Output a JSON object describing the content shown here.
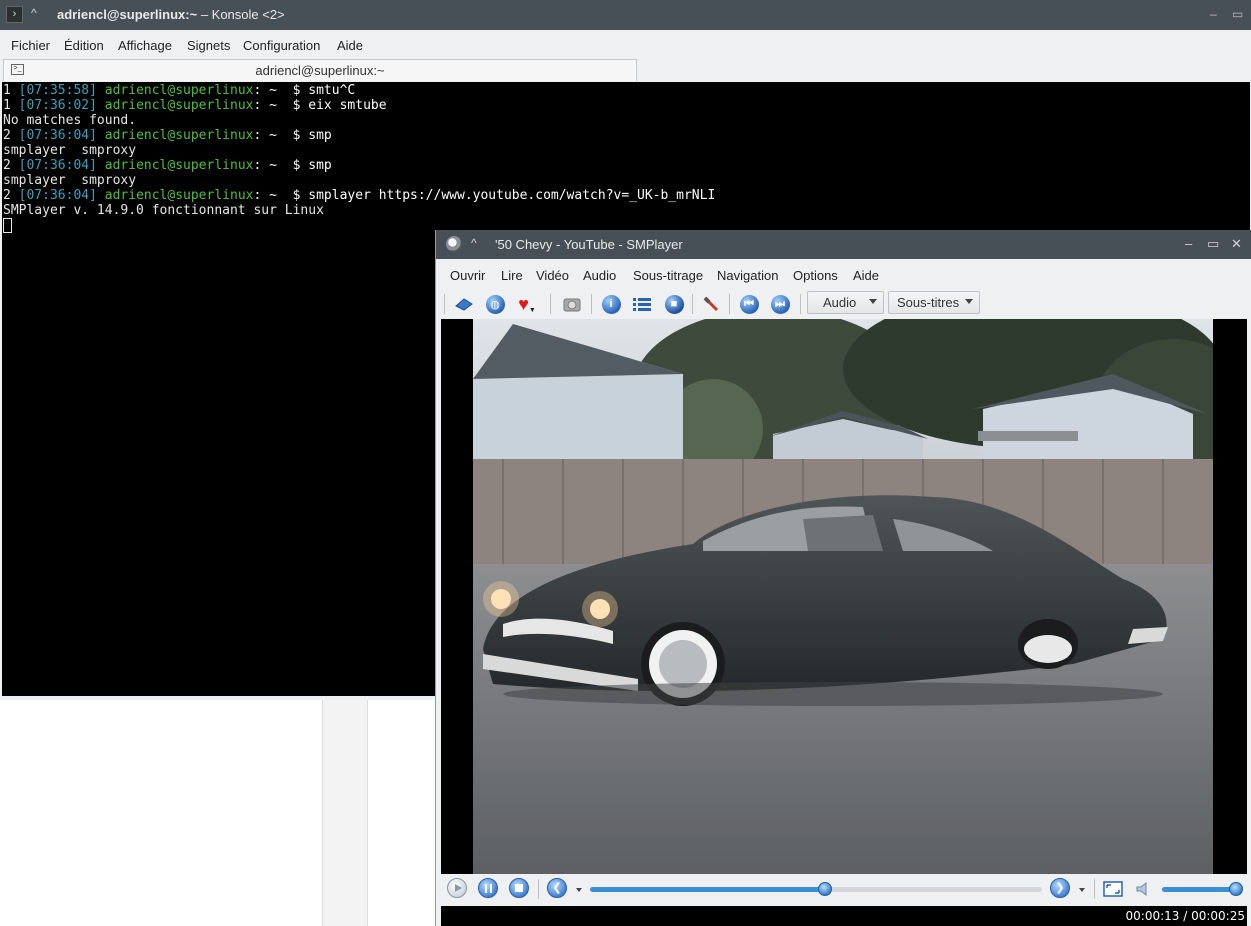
{
  "konsole": {
    "title_user": "adriencl@superlinux:~",
    "title_app": " – Konsole ",
    "title_tab_count": "<2>",
    "menu": [
      "Fichier",
      "Édition",
      "Affichage",
      "Signets",
      "Configuration",
      "Aide"
    ],
    "tab_label": "adriencl@superlinux:~",
    "terminal_lines": [
      {
        "num": "1",
        "time": "[07:35:58]",
        "user": "adriencl@superlinux",
        "sep": ": ~  $ ",
        "cmd": "smtu^C"
      },
      {
        "num": "1",
        "time": "[07:36:02]",
        "user": "adriencl@superlinux",
        "sep": ": ~  $ ",
        "cmd": "eix smtube"
      },
      {
        "output": "No matches found."
      },
      {
        "num": "2",
        "time": "[07:36:04]",
        "user": "adriencl@superlinux",
        "sep": ": ~  $ ",
        "cmd": "smp"
      },
      {
        "output": "smplayer  smproxy"
      },
      {
        "num": "2",
        "time": "[07:36:04]",
        "user": "adriencl@superlinux",
        "sep": ": ~  $ ",
        "cmd": "smp"
      },
      {
        "output": "smplayer  smproxy"
      },
      {
        "num": "2",
        "time": "[07:36:04]",
        "user": "adriencl@superlinux",
        "sep": ": ~  $ ",
        "cmd": "smplayer https://www.youtube.com/watch?v=_UK-b_mrNLI"
      },
      {
        "output": "SMPlayer v. 14.9.0 fonctionnant sur Linux"
      }
    ]
  },
  "smplayer": {
    "title": "'50 Chevy - YouTube - SMPlayer",
    "menu": [
      "Ouvrir",
      "Lire",
      "Vidéo",
      "Audio",
      "Sous-titrage",
      "Navigation",
      "Options",
      "Aide"
    ],
    "toolbar": {
      "audio_label": "Audio",
      "subtitles_label": "Sous-titres"
    },
    "progress_fraction": 0.52,
    "volume_fraction": 0.98,
    "time_display": "00:00:13 / 00:00:25"
  }
}
